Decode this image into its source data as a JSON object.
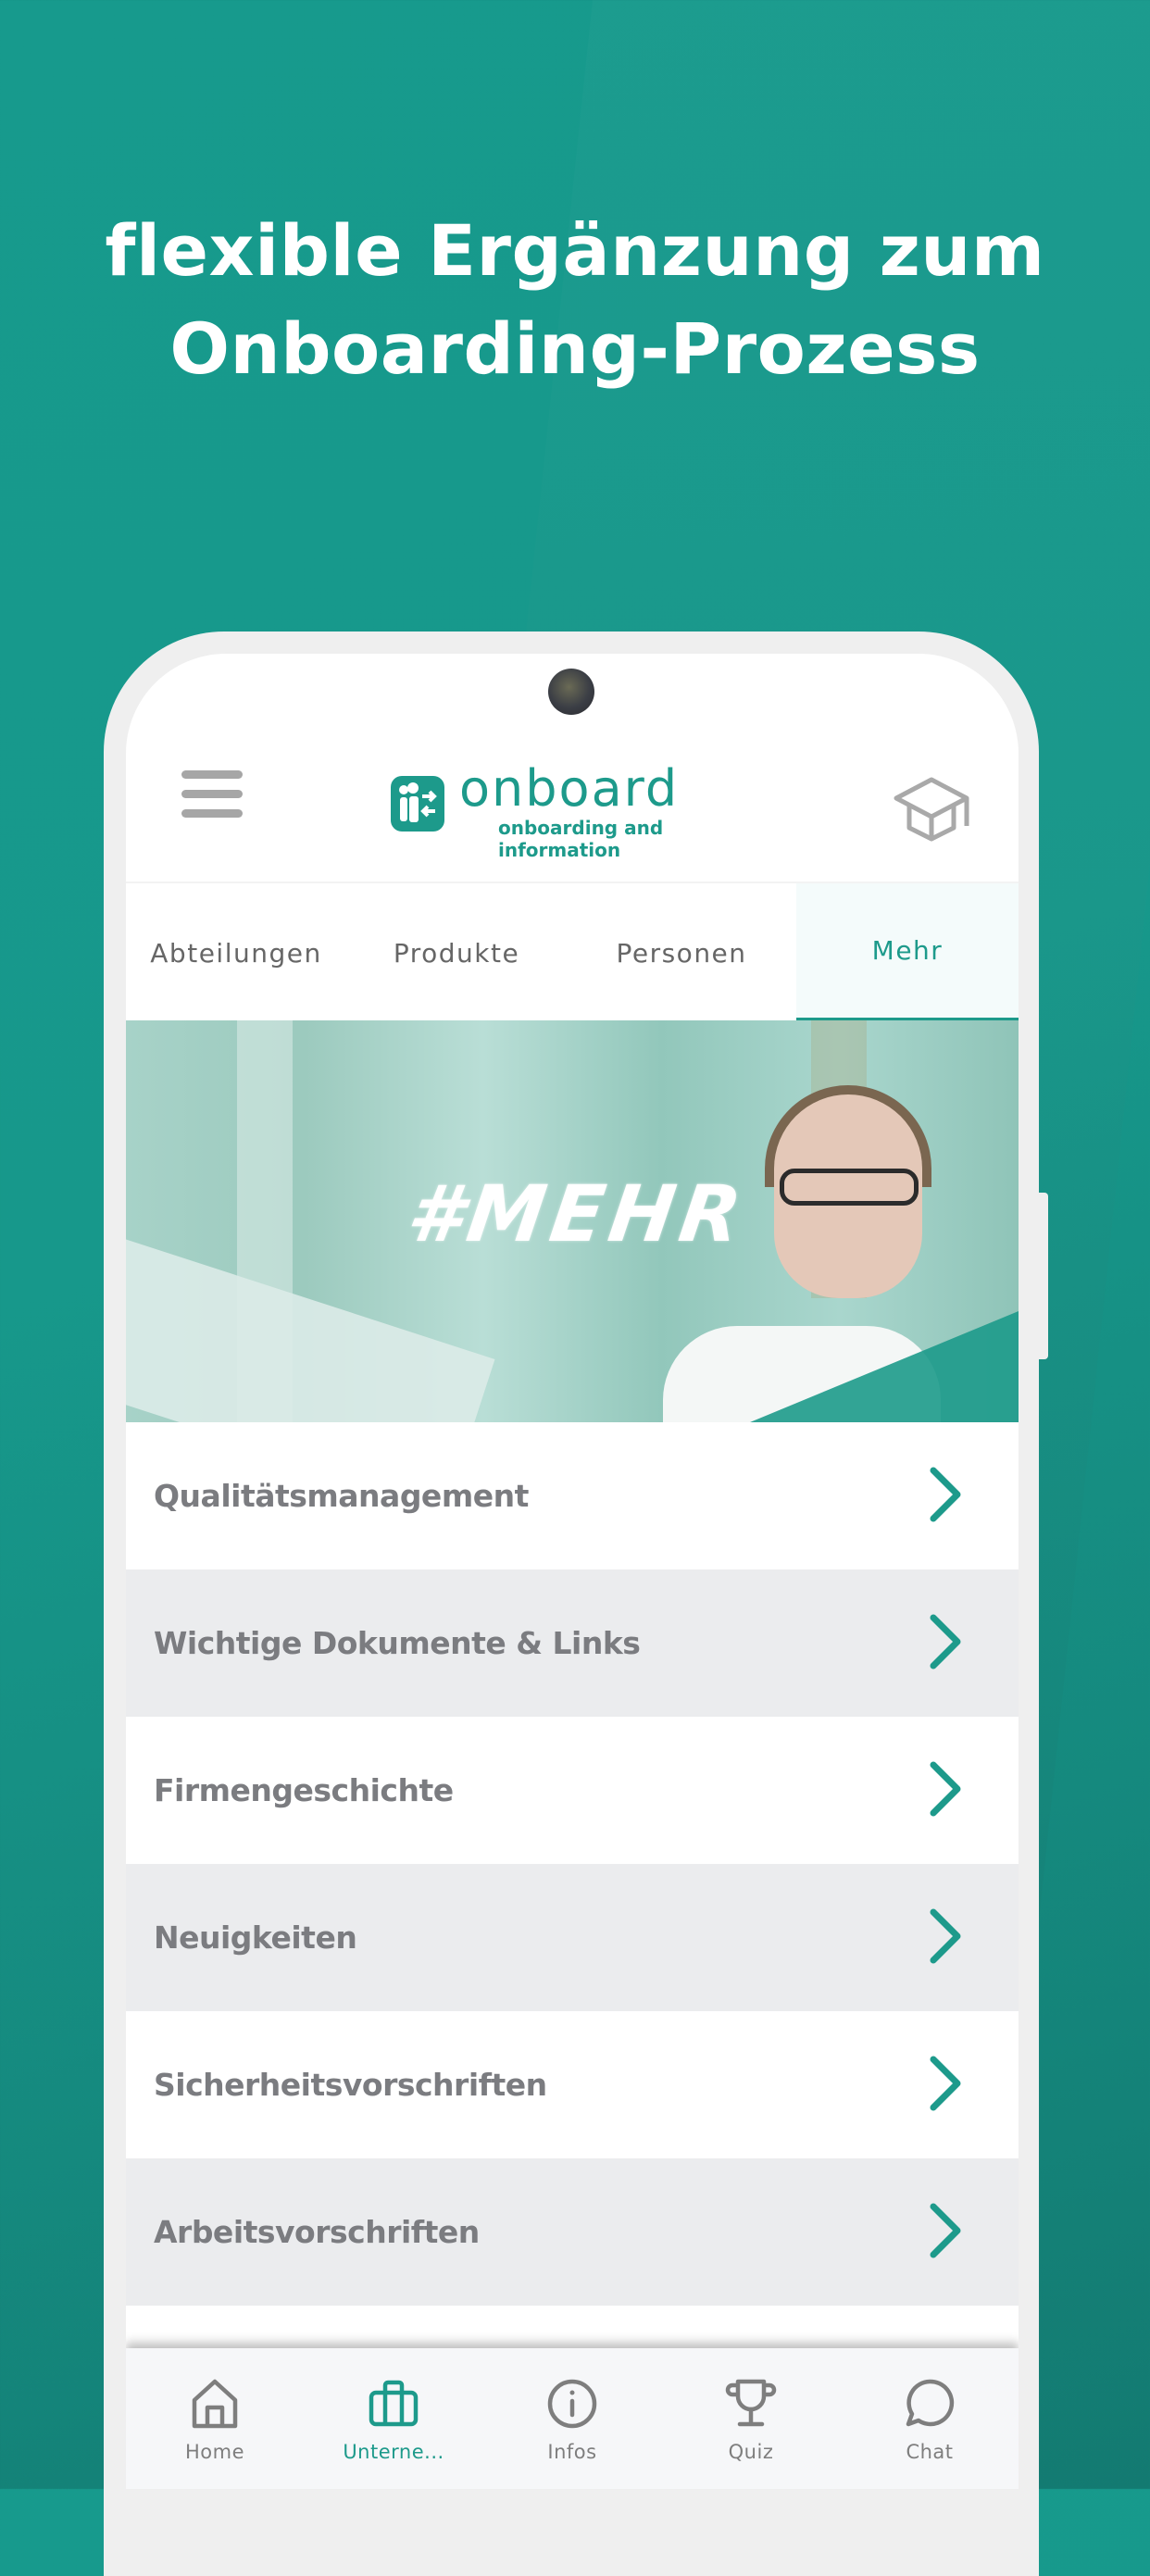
{
  "headline": {
    "line1": "flexible Ergänzung zum",
    "line2": "Onboarding-Prozess"
  },
  "app": {
    "logo_word": "onboard",
    "logo_tagline": "onboarding and information",
    "menu_icon": "hamburger-icon",
    "right_icon": "graduation-cap-icon"
  },
  "tabs": [
    {
      "label": "Abteilungen",
      "active": false
    },
    {
      "label": "Produkte",
      "active": false
    },
    {
      "label": "Personen",
      "active": false
    },
    {
      "label": "Mehr",
      "active": true
    }
  ],
  "banner": {
    "text": "#MEHR"
  },
  "list": [
    {
      "label": "Qualitätsmanagement"
    },
    {
      "label": "Wichtige Dokumente & Links"
    },
    {
      "label": "Firmengeschichte"
    },
    {
      "label": "Neuigkeiten"
    },
    {
      "label": "Sicherheitsvorschriften"
    },
    {
      "label": "Arbeitsvorschriften"
    }
  ],
  "bottom_nav": [
    {
      "label": "Home",
      "icon": "home-icon",
      "active": false
    },
    {
      "label": "Unterne...",
      "icon": "briefcase-icon",
      "active": true
    },
    {
      "label": "Infos",
      "icon": "info-icon",
      "active": false
    },
    {
      "label": "Quiz",
      "icon": "trophy-icon",
      "active": false
    },
    {
      "label": "Chat",
      "icon": "chat-icon",
      "active": false
    }
  ],
  "colors": {
    "background": "#179a8d",
    "accent": "#1d9a8b",
    "text_gray": "#7b7c80",
    "icon_gray": "#7e7e7e",
    "list_alt_bg": "#ebecee"
  }
}
